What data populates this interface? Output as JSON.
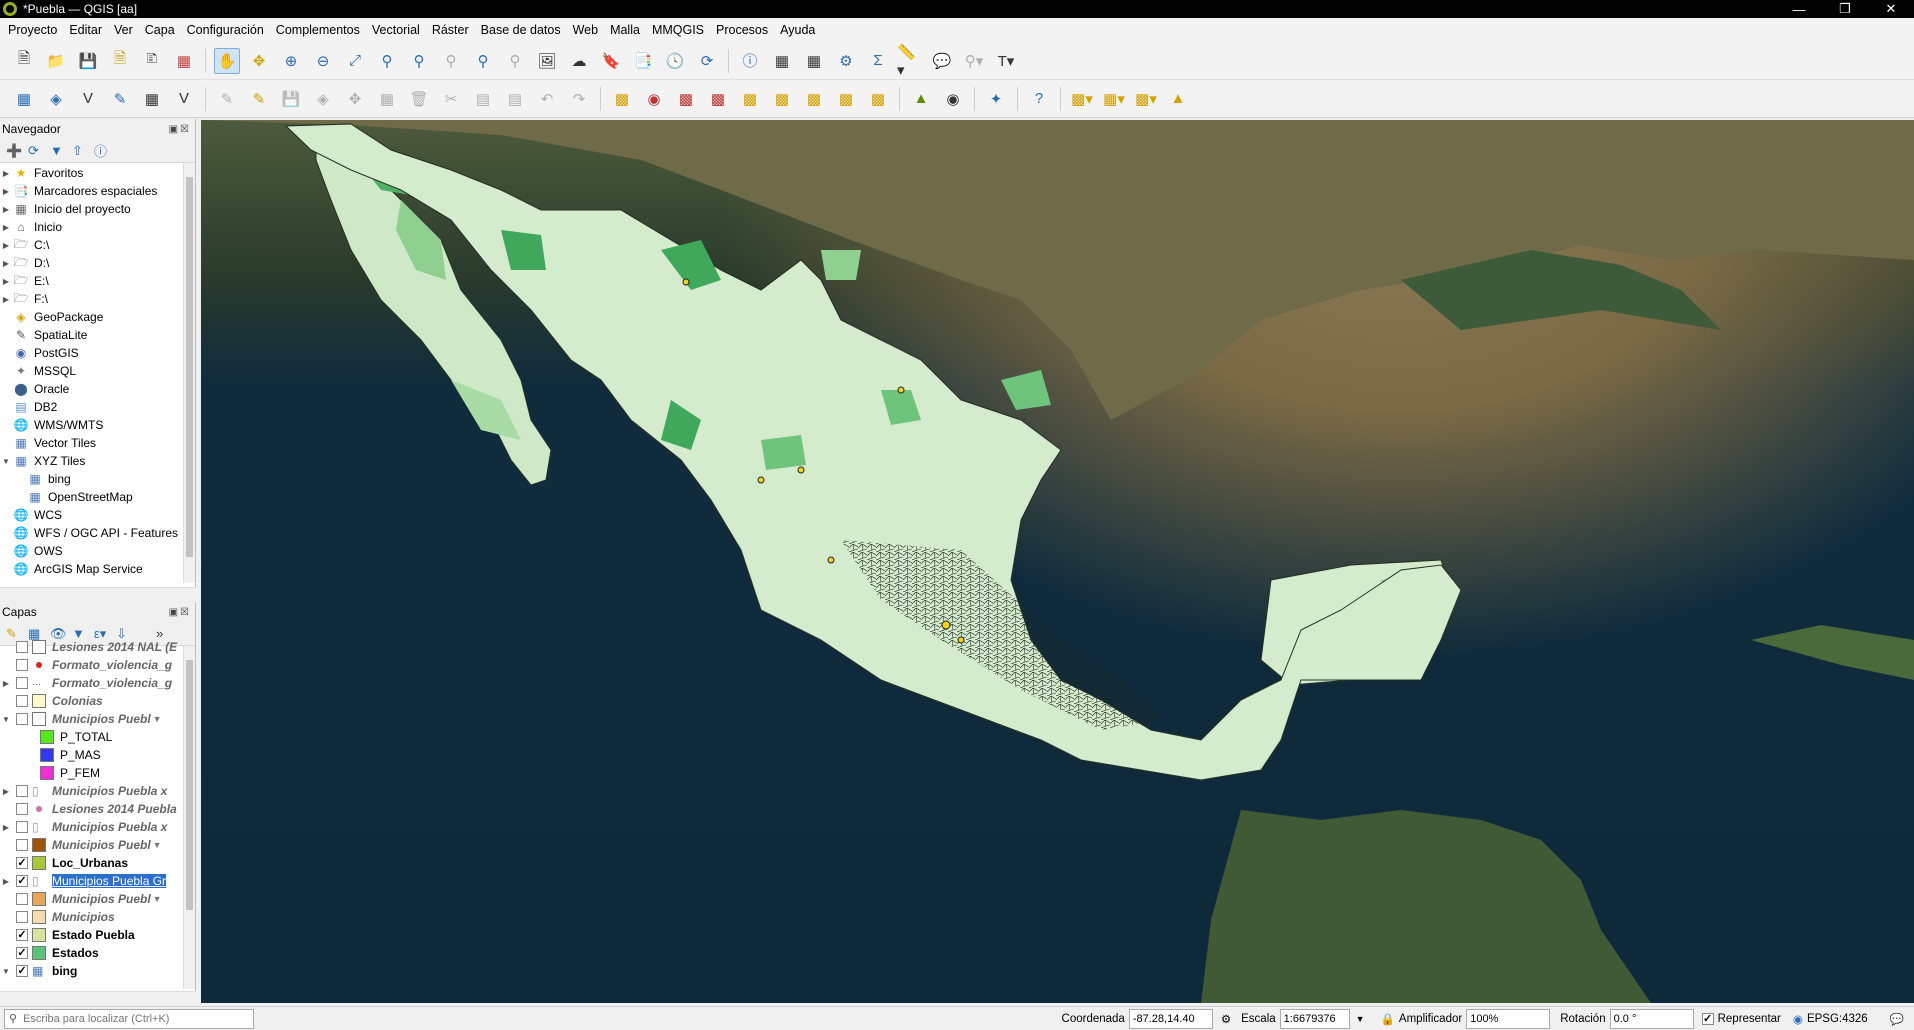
{
  "window": {
    "title": "*Puebla — QGIS [aa]"
  },
  "menu": [
    "Proyecto",
    "Editar",
    "Ver",
    "Capa",
    "Configuración",
    "Complementos",
    "Vectorial",
    "Ráster",
    "Base de datos",
    "Web",
    "Malla",
    "MMQGIS",
    "Procesos",
    "Ayuda"
  ],
  "navigator": {
    "title": "Navegador",
    "items": [
      {
        "label": "Favoritos",
        "icon": "star-icon",
        "expander": true
      },
      {
        "label": "Marcadores espaciales",
        "icon": "bookmark-icon",
        "expander": true
      },
      {
        "label": "Inicio del proyecto",
        "icon": "project-home-icon",
        "expander": true
      },
      {
        "label": "Inicio",
        "icon": "home-folder-icon",
        "expander": true
      },
      {
        "label": "C:\\",
        "icon": "drive-icon",
        "expander": true
      },
      {
        "label": "D:\\",
        "icon": "drive-icon",
        "expander": true
      },
      {
        "label": "E:\\",
        "icon": "drive-icon",
        "expander": true
      },
      {
        "label": "F:\\",
        "icon": "drive-icon",
        "expander": true
      },
      {
        "label": "GeoPackage",
        "icon": "geopackage-icon",
        "expander": false
      },
      {
        "label": "SpatiaLite",
        "icon": "spatialite-icon",
        "expander": false
      },
      {
        "label": "PostGIS",
        "icon": "postgis-icon",
        "expander": false
      },
      {
        "label": "MSSQL",
        "icon": "mssql-icon",
        "expander": false
      },
      {
        "label": "Oracle",
        "icon": "oracle-icon",
        "expander": false
      },
      {
        "label": "DB2",
        "icon": "db2-icon",
        "expander": false
      },
      {
        "label": "WMS/WMTS",
        "icon": "globe-icon",
        "expander": false
      },
      {
        "label": "Vector Tiles",
        "icon": "grid-icon",
        "expander": false
      },
      {
        "label": "XYZ Tiles",
        "icon": "grid-icon",
        "expander": true,
        "open": true
      },
      {
        "label": "bing",
        "icon": "grid-icon",
        "child": true
      },
      {
        "label": "OpenStreetMap",
        "icon": "grid-icon",
        "child": true
      },
      {
        "label": "WCS",
        "icon": "globe-icon",
        "expander": false
      },
      {
        "label": "WFS / OGC API - Features",
        "icon": "globe-icon",
        "expander": false
      },
      {
        "label": "OWS",
        "icon": "globe-icon",
        "expander": false
      },
      {
        "label": "ArcGIS Map Service",
        "icon": "globe-icon",
        "expander": false
      }
    ]
  },
  "layers": {
    "title": "Capas",
    "items": [
      {
        "label": "Lesiones 2014 NAL (E",
        "checked": false,
        "style": "it",
        "swatch": "#ffffff",
        "expander": false
      },
      {
        "label": "Formato_violencia_g",
        "checked": false,
        "style": "it",
        "swatch": "point-red",
        "expander": false
      },
      {
        "label": "Formato_violencia_g",
        "checked": false,
        "style": "it",
        "swatch": "dots",
        "expander": true
      },
      {
        "label": "Colonias",
        "checked": false,
        "style": "it",
        "swatch": "#fff9cc",
        "expander": false
      },
      {
        "label": "Municipios Puebl",
        "checked": false,
        "style": "it",
        "swatch": "#ffffff",
        "expander": true,
        "open": true,
        "filter": true
      },
      {
        "label": "P_TOTAL",
        "legend": true,
        "swatch": "#55e81a"
      },
      {
        "label": "P_MAS",
        "legend": true,
        "swatch": "#2f39f0"
      },
      {
        "label": "P_FEM",
        "legend": true,
        "swatch": "#f02fd6"
      },
      {
        "label": "Municipios Puebla x",
        "checked": false,
        "style": "it",
        "swatch": "poly-gray",
        "expander": true
      },
      {
        "label": "Lesiones 2014 Puebla",
        "checked": false,
        "style": "it",
        "swatch": "point-pink",
        "expander": false
      },
      {
        "label": "Municipios Puebla x",
        "checked": false,
        "style": "it",
        "swatch": "poly-gray",
        "expander": true
      },
      {
        "label": "Municipios Puebl",
        "checked": false,
        "style": "it",
        "swatch": "#a0520f",
        "expander": false,
        "filter": true
      },
      {
        "label": "Loc_Urbanas",
        "checked": true,
        "style": "bd",
        "swatch": "#a7c83a",
        "expander": false
      },
      {
        "label": "Municipios Puebla Gr",
        "checked": true,
        "style": "sel",
        "swatch": "poly-gray",
        "expander": true
      },
      {
        "label": "Municipios Puebl",
        "checked": false,
        "style": "it",
        "swatch": "#e8a45a",
        "expander": false,
        "filter": true
      },
      {
        "label": "Municipios",
        "checked": false,
        "style": "it",
        "swatch": "#f4ddb0",
        "expander": false
      },
      {
        "label": "Estado Puebla",
        "checked": true,
        "style": "bd",
        "swatch": "#d8e3a0",
        "expander": false
      },
      {
        "label": "Estados",
        "checked": true,
        "style": "bd",
        "swatch": "#5cc47a",
        "expander": false
      },
      {
        "label": "bing",
        "checked": true,
        "style": "bd",
        "swatch": "grid",
        "expander": true,
        "open": true
      }
    ]
  },
  "status": {
    "search_placeholder": "Escriba para localizar (Ctrl+K)",
    "coord_label": "Coordenada",
    "coord_value": "-87.28,14.40",
    "scale_label": "Escala",
    "scale_value": "1:6679376",
    "magnifier_label": "Amplificador",
    "magnifier_value": "100%",
    "rotation_label": "Rotación",
    "rotation_value": "0.0 °",
    "render_label": "Representar",
    "crs_label": "EPSG:4326"
  },
  "colors": {
    "selection": "#2a6fce",
    "water": "#0e2a3a",
    "land_light": "#cfe8c8",
    "land_mid": "#8fd091",
    "land_dark": "#3fa85a"
  }
}
